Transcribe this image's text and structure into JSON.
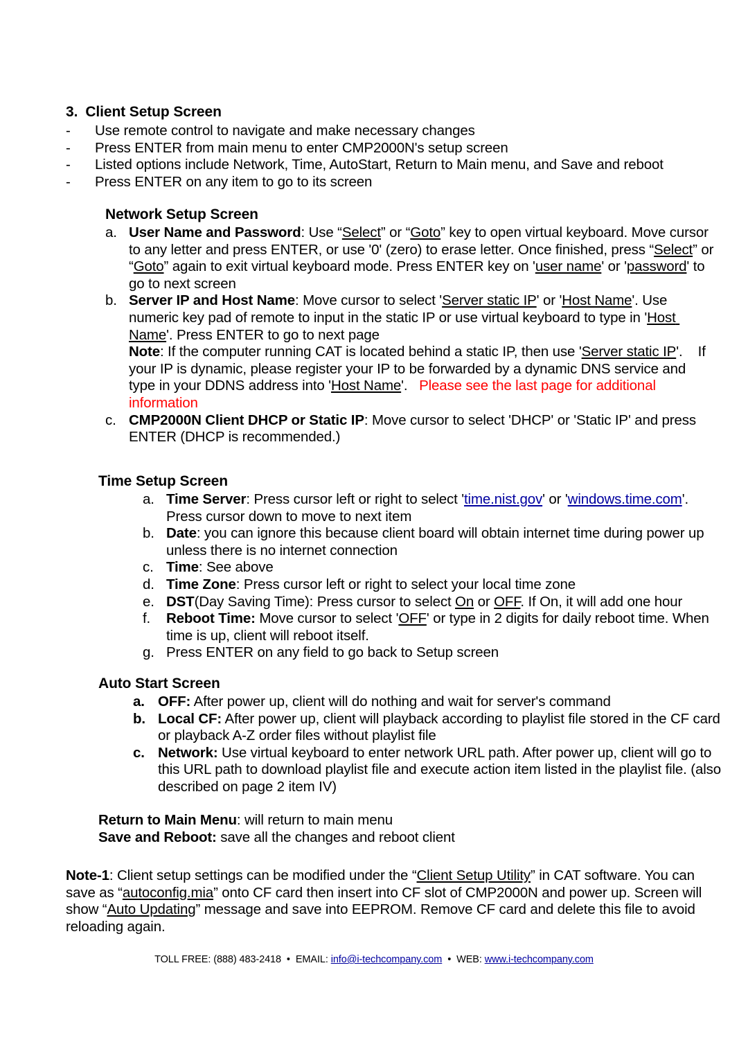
{
  "document": {
    "section_number": "3.",
    "section_title": "Client Setup Screen",
    "intro_bullets": [
      {
        "marker": "-",
        "text": "Use remote control to navigate and make necessary changes"
      },
      {
        "marker": "-",
        "text": "Press ENTER from main menu to enter CMP2000N's setup screen"
      },
      {
        "marker": "-",
        "text": "Listed options include Network, Time, AutoStart, Return to Main menu, and Save and reboot"
      },
      {
        "marker": "-",
        "text": "Press ENTER on any item to go to its screen"
      }
    ],
    "network_setup": {
      "heading": "Network Setup Screen",
      "items": [
        {
          "marker": "a.",
          "term": "User Name and Password",
          "segments": [
            {
              "t": "User Name and Password",
              "bold": true
            },
            {
              "t": ": Use “"
            },
            {
              "t": "Select",
              "underline": true
            },
            {
              "t": "” or “"
            },
            {
              "t": "Goto",
              "underline": true
            },
            {
              "t": "” key to open virtual keyboard. Move cursor to any letter and press ENTER, or use '0' (zero) to erase letter. Once finished, press “"
            },
            {
              "t": "Select",
              "underline": true
            },
            {
              "t": "” or “"
            },
            {
              "t": "Goto",
              "underline": true
            },
            {
              "t": "” again to exit virtual keyboard mode. Press ENTER key on '"
            },
            {
              "t": "user name",
              "underline": true
            },
            {
              "t": "' or '"
            },
            {
              "t": "password",
              "underline": true
            },
            {
              "t": "' to go to next screen"
            }
          ]
        },
        {
          "marker": "b.",
          "term": "Server IP and Host Name",
          "segments": [
            {
              "t": "Server IP and Host Name",
              "bold": true
            },
            {
              "t": ": Move cursor to select '"
            },
            {
              "t": "Server static IP",
              "underline": true
            },
            {
              "t": "' or '"
            },
            {
              "t": "Host Name",
              "underline": true
            },
            {
              "t": "'. Use numeric key pad of remote to input in the static IP or use virtual keyboard to type in '"
            },
            {
              "t": "Host Name",
              "underline": true
            },
            {
              "t": "'. Press ENTER to go to next page\n"
            },
            {
              "t": "Note",
              "bold": true
            },
            {
              "t": ": If the computer running CAT is located behind a static IP, then use '"
            },
            {
              "t": "Server static IP",
              "underline": true
            },
            {
              "t": "'.    If your IP is dynamic, please register your IP to be forwarded by a dynamic DNS service and type in your DDNS address into '"
            },
            {
              "t": "Host Name",
              "underline": true
            },
            {
              "t": "'.   "
            },
            {
              "t": "Please see the last page for additional information",
              "red": true
            }
          ]
        },
        {
          "marker": "c.",
          "term": "CMP2000N Client DHCP or Static IP",
          "segments": [
            {
              "t": "CMP2000N Client DHCP or Static IP",
              "bold": true
            },
            {
              "t": ": Move cursor to select 'DHCP' or 'Static IP' and press\nENTER (DHCP is recommended.)"
            }
          ]
        }
      ]
    },
    "time_setup": {
      "heading": "Time Setup Screen",
      "items": [
        {
          "marker": "a.",
          "term": "Time Server",
          "segments": [
            {
              "t": "Time Server",
              "bold": true
            },
            {
              "t": ": Press cursor left or right to select '"
            },
            {
              "t": "time.nist.gov",
              "link": true
            },
            {
              "t": "' or '"
            },
            {
              "t": "windows.time.com",
              "link": true
            },
            {
              "t": "'. Press cursor down to move to next item"
            }
          ]
        },
        {
          "marker": "b.",
          "term": "Date",
          "segments": [
            {
              "t": "Date",
              "bold": true
            },
            {
              "t": ": you can ignore this because client board will obtain internet time during power up unless there is no internet connection"
            }
          ]
        },
        {
          "marker": "c.",
          "term": "Time",
          "segments": [
            {
              "t": "Time",
              "bold": true
            },
            {
              "t": ": See above"
            }
          ]
        },
        {
          "marker": "d.",
          "term": "Time Zone",
          "segments": [
            {
              "t": "Time Zone",
              "bold": true
            },
            {
              "t": ": Press cursor left or right to select your local time zone"
            }
          ]
        },
        {
          "marker": "e.",
          "term": "DST",
          "segments": [
            {
              "t": "DST",
              "bold": true
            },
            {
              "t": "(Day Saving Time): Press cursor to select "
            },
            {
              "t": "On",
              "underline": true
            },
            {
              "t": " or "
            },
            {
              "t": "OFF",
              "underline": true
            },
            {
              "t": ". If On, it will add one hour"
            }
          ]
        },
        {
          "marker": "f.",
          "term": "Reboot Time:",
          "segments": [
            {
              "t": "Reboot Time:",
              "bold": true
            },
            {
              "t": " Move cursor to select '"
            },
            {
              "t": "OFF",
              "underline": true
            },
            {
              "t": "' or type in 2 digits for daily reboot time. When time is up, client will reboot itself."
            }
          ]
        },
        {
          "marker": "g.",
          "term": "",
          "segments": [
            {
              "t": "Press ENTER on any field to go back to Setup screen"
            }
          ]
        }
      ]
    },
    "auto_start": {
      "heading": "Auto Start Screen",
      "items": [
        {
          "marker": "a.",
          "term": "OFF:",
          "segments": [
            {
              "t": "OFF:",
              "bold": true
            },
            {
              "t": " After power up, client will do nothing and wait for server's command"
            }
          ]
        },
        {
          "marker": "b.",
          "term": "Local CF:",
          "segments": [
            {
              "t": "Local CF:",
              "bold": true
            },
            {
              "t": " After power up, client will playback according to playlist file stored in the CF card or playback A-Z order files without playlist file"
            }
          ]
        },
        {
          "marker": "c.",
          "term": "Network:",
          "segments": [
            {
              "t": "Network:",
              "bold": true
            },
            {
              "t": " Use virtual keyboard to enter network URL path. After power up, client will go to this URL path to download playlist file and execute action item listed in the playlist file. (also described on page 2 item IV)"
            }
          ]
        }
      ]
    },
    "return_lines": [
      {
        "segments": [
          {
            "t": "Return to Main Menu",
            "bold": true
          },
          {
            "t": ": will return to main menu"
          }
        ]
      },
      {
        "segments": [
          {
            "t": "Save and Reboot:",
            "bold": true
          },
          {
            "t": " save all the changes and reboot client"
          }
        ]
      }
    ],
    "note1": {
      "segments": [
        {
          "t": "Note-1",
          "bold": true
        },
        {
          "t": ": Client setup settings can be modified under the “"
        },
        {
          "t": "Client Setup Utility",
          "underline": true
        },
        {
          "t": "” in CAT software. You can save as “"
        },
        {
          "t": "autoconfig.mia",
          "underline": true
        },
        {
          "t": "” onto CF card then insert into CF slot of CMP2000N and power up. Screen will show “"
        },
        {
          "t": "Auto Updating",
          "underline": true
        },
        {
          "t": "” message and save into EEPROM. Remove CF card and delete this file to avoid reloading again."
        }
      ]
    },
    "footer": {
      "segments": [
        {
          "t": "TOLL FREE: (888) 483-2418"
        },
        {
          "t": " • ",
          "sep": true
        },
        {
          "t": "EMAIL: "
        },
        {
          "t": "info@i-techcompany.com",
          "link": true
        },
        {
          "t": " • ",
          "sep": true
        },
        {
          "t": "WEB: "
        },
        {
          "t": "www.i-techcompany.com",
          "link": true
        }
      ]
    }
  },
  "colors": {
    "text": "#000000",
    "red_note": "#ff0000",
    "hyperlink": "#00009f",
    "background": "#ffffff"
  }
}
